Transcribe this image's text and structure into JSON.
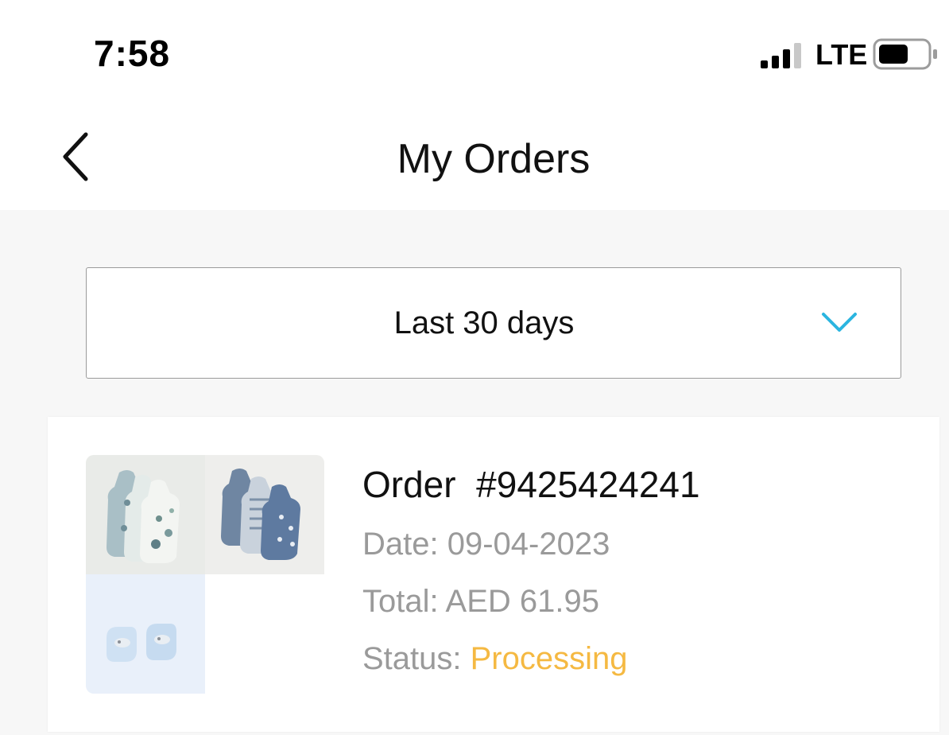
{
  "status_bar": {
    "time": "7:58",
    "network": "LTE",
    "signal_icon": "signal-bars-icon",
    "battery_icon": "battery-icon"
  },
  "header": {
    "title": "My Orders",
    "back_icon": "chevron-left-icon"
  },
  "filter": {
    "selected": "Last 30 days",
    "icon": "chevron-down-icon",
    "accent_color": "#2bb5e0"
  },
  "orders": [
    {
      "number_prefix": "Order",
      "number": "#9425424241",
      "date_label": "Date: ",
      "date": "09-04-2023",
      "total_label": "Total: ",
      "total": "AED 61.95",
      "status_label": "Status: ",
      "status": "Processing",
      "status_color": "#f5b942",
      "thumbnails": [
        "printed-bodysuits-image",
        "striped-bodysuits-image",
        "baby-booties-image"
      ]
    }
  ]
}
